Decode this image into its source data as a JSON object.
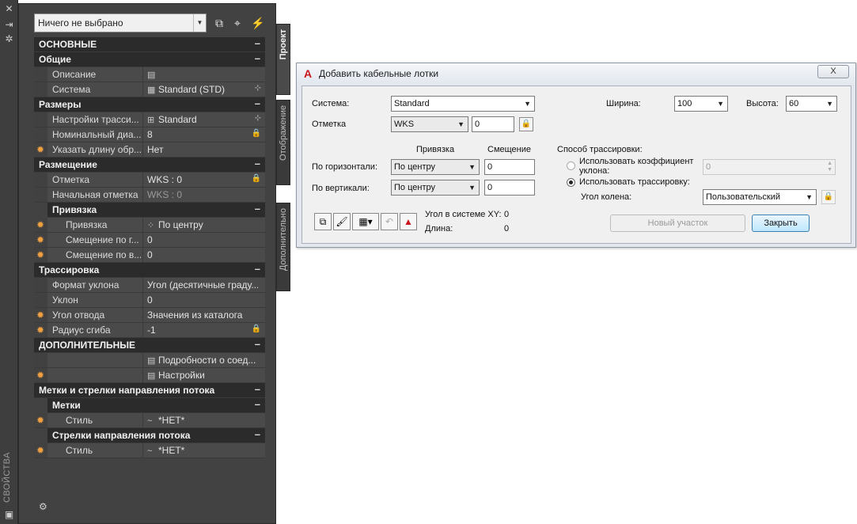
{
  "palette": {
    "side_title": "СВОЙСТВА",
    "selection_combo": "Ничего не выбрано",
    "tabs": [
      "Проект",
      "Отображение",
      "Дополнительно"
    ],
    "rows": [
      {
        "kind": "cat0",
        "label": "ОСНОВНЫЕ",
        "toggle": "–"
      },
      {
        "kind": "cat1",
        "label": "Общие",
        "toggle": "–"
      },
      {
        "kind": "prop",
        "name": "Описание",
        "value": "",
        "value_icon": "description-icon"
      },
      {
        "kind": "prop",
        "name": "Система",
        "value": "Standard (STD)",
        "value_icon": "system-icon",
        "right": "browse"
      },
      {
        "kind": "cat1",
        "label": "Размеры",
        "toggle": "–"
      },
      {
        "kind": "prop",
        "name": "Настройки трасси...",
        "value": "Standard",
        "value_icon": "settings-icon",
        "right": "browse"
      },
      {
        "kind": "prop",
        "name": "Номинальный диа...",
        "value": "8",
        "right": "lock"
      },
      {
        "kind": "prop",
        "name": "Указать длину обр...",
        "value": "Нет",
        "star": true
      },
      {
        "kind": "cat1",
        "label": "Размещение",
        "toggle": "–"
      },
      {
        "kind": "prop",
        "name": "Отметка",
        "value": "WKS : 0",
        "right": "lock"
      },
      {
        "kind": "prop",
        "name": "Начальная отметка",
        "value": "WKS : 0",
        "dim": true
      },
      {
        "kind": "cat2",
        "label": "Привязка",
        "toggle": "–"
      },
      {
        "kind": "prop",
        "sub": true,
        "name": "Привязка",
        "value": "По центру",
        "value_icon": "justification-icon",
        "star": true
      },
      {
        "kind": "prop",
        "sub": true,
        "name": "Смещение по г...",
        "value": "0",
        "star": true
      },
      {
        "kind": "prop",
        "sub": true,
        "name": "Смещение по в...",
        "value": "0",
        "star": true
      },
      {
        "kind": "cat1",
        "label": "Трассировка",
        "toggle": "–"
      },
      {
        "kind": "prop",
        "name": "Формат уклона",
        "value": "Угол (десятичные граду..."
      },
      {
        "kind": "prop",
        "name": "Уклон",
        "value": "0"
      },
      {
        "kind": "prop",
        "name": "Угол отвода",
        "value": "Значения из каталога",
        "star": true
      },
      {
        "kind": "prop",
        "name": "Радиус сгиба",
        "value": "-1",
        "star": true,
        "right": "lock"
      },
      {
        "kind": "cat0",
        "label": "ДОПОЛНИТЕЛЬНЫЕ",
        "toggle": "–"
      },
      {
        "kind": "prop",
        "name": "",
        "value": "Подробности о соед...",
        "value_icon": "details-icon"
      },
      {
        "kind": "prop",
        "name": "",
        "value": "Настройки",
        "value_icon": "details-icon",
        "star": true
      },
      {
        "kind": "cat1",
        "label": "Метки и стрелки направления потока",
        "toggle": "–"
      },
      {
        "kind": "cat2",
        "label": "Метки",
        "toggle": "–"
      },
      {
        "kind": "prop",
        "sub": true,
        "name": "Стиль",
        "value": "*НЕТ*",
        "value_icon": "style-icon",
        "star": true
      },
      {
        "kind": "cat2",
        "label": "Стрелки направления потока",
        "toggle": "–"
      },
      {
        "kind": "prop",
        "sub": true,
        "name": "Стиль",
        "value": "*НЕТ*",
        "value_icon": "style-icon",
        "star": true
      }
    ]
  },
  "dialog": {
    "title": "Добавить кабельные лотки",
    "close": "X",
    "system_label": "Система:",
    "system_value": "Standard",
    "elevation_label": "Отметка",
    "elevation_combo": "WKS",
    "elevation_value": "0",
    "width_label": "Ширина:",
    "width_value": "100",
    "height_label": "Высота:",
    "height_value": "60",
    "justify_header": "Привязка",
    "offset_header": "Смещение",
    "horiz_label": "По горизонтали:",
    "horiz_justify": "По центру",
    "horiz_offset": "0",
    "vert_label": "По вертикали:",
    "vert_justify": "По центру",
    "vert_offset": "0",
    "routing_label": "Способ трассировки:",
    "option_slope": "Использовать коэффициент уклона:",
    "slope_value": "0",
    "option_routing": "Использовать трассировку:",
    "bend_label": "Угол колена:",
    "bend_value": "Пользовательский",
    "xy_angle_label": "Угол в системе XY:",
    "xy_angle_value": "0",
    "length_label": "Длина:",
    "length_value": "0",
    "new_segment": "Новый участок",
    "close_button": "Закрыть"
  }
}
